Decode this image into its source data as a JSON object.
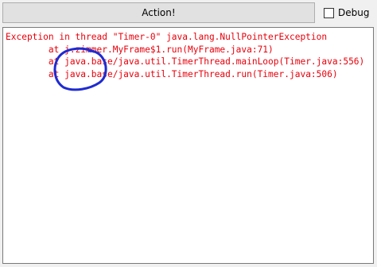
{
  "toolbar": {
    "action_label": "Action!",
    "debug_label": "Debug",
    "debug_checked": false
  },
  "output": {
    "text_color": "#e8000b",
    "lines": [
      "Exception in thread \"Timer-0\" java.lang.NullPointerException",
      "\tat j.zimmer.MyFrame$1.run(MyFrame.java:71)",
      "\tat java.base/java.util.TimerThread.mainLoop(Timer.java:556)",
      "\tat java.base/java.util.TimerThread.run(Timer.java:506)"
    ]
  },
  "annotation": {
    "color": "#1f2bd1"
  }
}
